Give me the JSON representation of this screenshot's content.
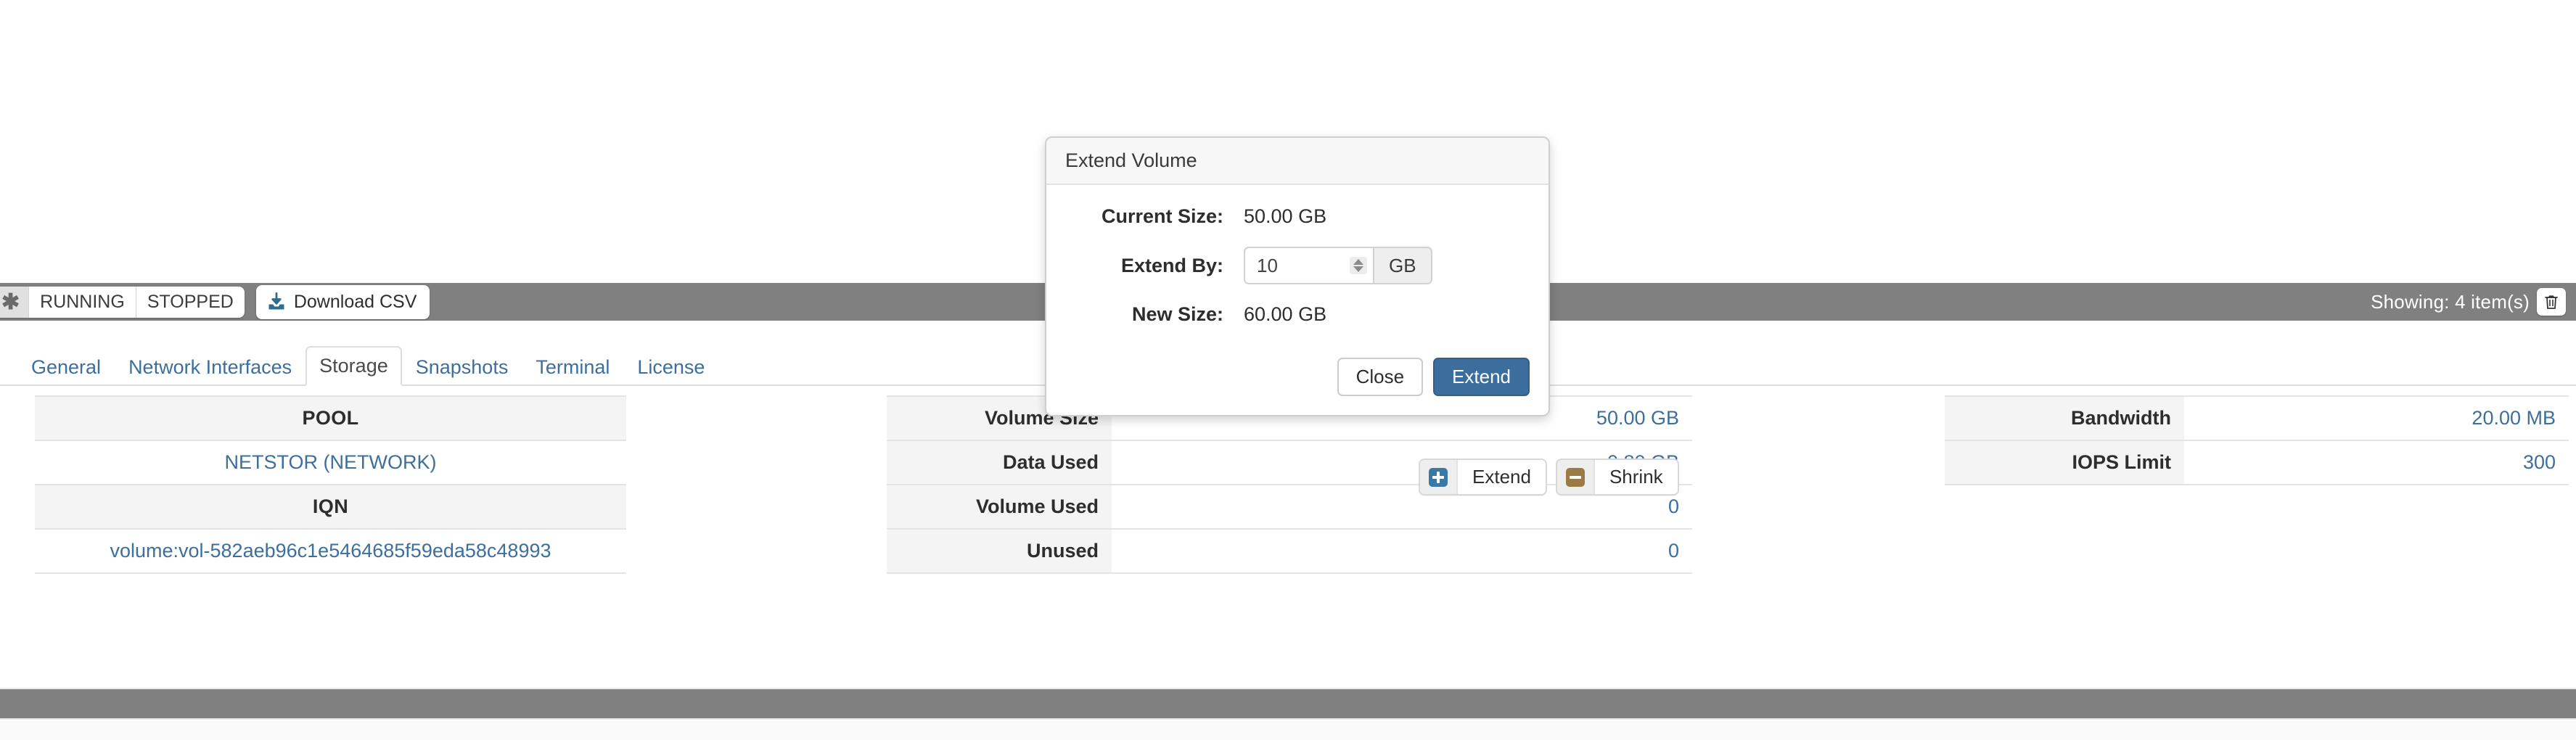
{
  "toolbar": {
    "filter_group": [
      {
        "label": "",
        "icon": "asterisk-icon",
        "active": true
      },
      {
        "label": "RUNNING",
        "icon": "",
        "active": false
      },
      {
        "label": "STOPPED",
        "icon": "",
        "active": false
      }
    ],
    "download_csv_label": "Download CSV",
    "download_icon": "download-icon",
    "showing_text": "Showing: 4 item(s)",
    "delete_icon": "trash-icon",
    "background_color": "#808080"
  },
  "tabs": [
    {
      "label": "General",
      "active": false
    },
    {
      "label": "Network Interfaces",
      "active": false
    },
    {
      "label": "Storage",
      "active": true
    },
    {
      "label": "Snapshots",
      "active": false
    },
    {
      "label": "Terminal",
      "active": false
    },
    {
      "label": "License",
      "active": false
    }
  ],
  "storage": {
    "pool_header": "POOL",
    "pool_value": "NETSTOR (NETWORK)",
    "iqn_header": "IQN",
    "iqn_value": "volume:vol-582aeb96c1e5464685f59eda58c48993",
    "metrics": [
      {
        "label": "Volume Size",
        "value": "50.00 GB"
      },
      {
        "label": "Data Used",
        "value": "0.80 GB"
      },
      {
        "label": "Volume Used",
        "value": "0"
      },
      {
        "label": "Unused",
        "value": "0"
      }
    ],
    "limits": [
      {
        "label": "Bandwidth",
        "value": "20.00 MB"
      },
      {
        "label": "IOPS Limit",
        "value": "300"
      }
    ],
    "actions": [
      {
        "label": "Extend",
        "icon": "plus-square-icon",
        "color": "#3a78a5"
      },
      {
        "label": "Shrink",
        "icon": "minus-square-icon",
        "color": "#9b7b45"
      }
    ],
    "link_color": "#3d6f9e"
  },
  "dialog": {
    "title": "Extend Volume",
    "current_size_label": "Current Size:",
    "current_size_value": "50.00 GB",
    "extend_by_label": "Extend By:",
    "extend_by_value": "10",
    "extend_by_unit": "GB",
    "new_size_label": "New Size:",
    "new_size_value": "60.00 GB",
    "close_label": "Close",
    "extend_label": "Extend",
    "primary_color": "#3b6e9c"
  }
}
